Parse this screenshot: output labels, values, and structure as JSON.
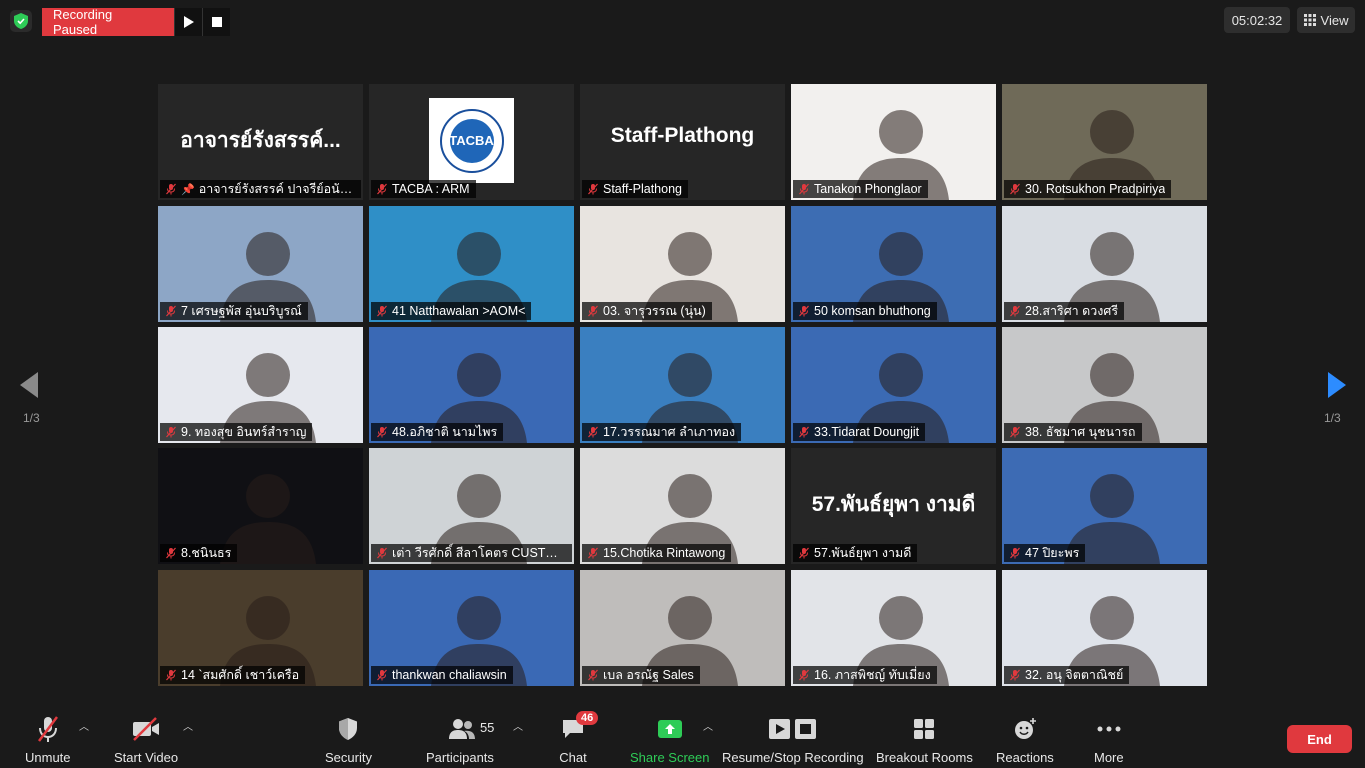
{
  "recording": {
    "status": "Recording Paused"
  },
  "timer": "05:02:32",
  "view_label": "View",
  "pagination": {
    "left": "1/3",
    "right": "1/3"
  },
  "tiles": [
    {
      "name": "อาจารย์รังสรรค์ ปาจรีย์อนันต์",
      "big": "อาจารย์รังสรรค์...",
      "kind": "text",
      "pinned": true
    },
    {
      "name": "TACBA : ARM",
      "kind": "logo",
      "logo_text": "TACBA"
    },
    {
      "name": "Staff-Plathong",
      "big": "Staff-Plathong",
      "kind": "text"
    },
    {
      "name": "Tanakon Phonglaor",
      "kind": "video",
      "bg": "#f2f0ee"
    },
    {
      "name": "30. Rotsukhon Pradpiriya",
      "kind": "video",
      "bg": "#6f6a58",
      "active": true
    },
    {
      "name": "7 เศรษฐพัส อุ่นบริบูรณ์",
      "kind": "video",
      "bg": "#8da6c6"
    },
    {
      "name": "41 Natthawalan >AOM<",
      "kind": "video",
      "bg": "#2f8fc7"
    },
    {
      "name": "03. จารุวรรณ (นุ่น)",
      "kind": "video",
      "bg": "#e8e4e0"
    },
    {
      "name": "50 komsan bhuthong",
      "kind": "video",
      "bg": "#3d6db3"
    },
    {
      "name": "28.สาริศา ดวงศรี",
      "kind": "video",
      "bg": "#d9dde3"
    },
    {
      "name": "9. ทองสุข อินทร์สำราญ",
      "kind": "video",
      "bg": "#e6e8ee"
    },
    {
      "name": "48.อภิชาติ นามไพร",
      "kind": "video",
      "bg": "#3a69b5"
    },
    {
      "name": "17.วรรณมาศ ลำเภาทอง",
      "kind": "video",
      "bg": "#3a7fc0"
    },
    {
      "name": "33.Tidarat Doungjit",
      "kind": "video",
      "bg": "#3b6ab4"
    },
    {
      "name": "38. ธัชมาศ นุชนารถ",
      "kind": "video",
      "bg": "#c7c8c9"
    },
    {
      "name": "8.ชนินธร",
      "kind": "video",
      "bg": "#101014"
    },
    {
      "name": "เต่า วีรศักดิ์ สีลาโคตร CUSTOM...",
      "kind": "video",
      "bg": "#cfd3d6"
    },
    {
      "name": "15.Chotika Rintawong",
      "kind": "video",
      "bg": "#dcdcdc"
    },
    {
      "name": "57.พันธ์ยุพา งามดี",
      "big": "57.พันธ์ยุพา งามดี",
      "kind": "text"
    },
    {
      "name": "47 ปิยะพร",
      "kind": "video",
      "bg": "#3d6bb4"
    },
    {
      "name": "14 `สมศักดิ์ เชาว์เครือ",
      "kind": "video",
      "bg": "#4a3d2c"
    },
    {
      "name": "thankwan chaliawsin",
      "kind": "video",
      "bg": "#3a69b5"
    },
    {
      "name": "เบล อรณัฐ Sales",
      "kind": "video",
      "bg": "#bfbdbb"
    },
    {
      "name": "16. ภาสพิชญ์ ทับเมี่ยง",
      "kind": "video",
      "bg": "#e2e4e8"
    },
    {
      "name": "32. อนุ จิตตาณิชย์",
      "kind": "video",
      "bg": "#dfe3ea"
    }
  ],
  "toolbar": {
    "unmute": "Unmute",
    "start_video": "Start Video",
    "security": "Security",
    "participants": "Participants",
    "participants_count": "55",
    "chat": "Chat",
    "chat_badge": "46",
    "share_screen": "Share Screen",
    "recording": "Resume/Stop Recording",
    "breakout": "Breakout Rooms",
    "reactions": "Reactions",
    "more": "More",
    "end": "End"
  },
  "colors": {
    "accent_red": "#e0393e",
    "share_green": "#2ecc57",
    "active_speaker": "#c6e05a"
  }
}
